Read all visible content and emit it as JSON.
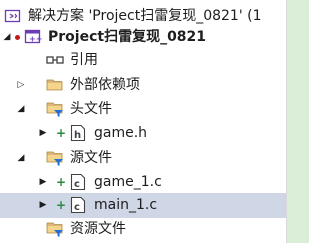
{
  "solution": {
    "label": "解决方案 'Project扫雷复现_0821' (1"
  },
  "project": {
    "label": "Project扫雷复现_0821"
  },
  "items": {
    "references": "引用",
    "external_deps": "外部依赖项",
    "header_files": "头文件",
    "game_h": "game.h",
    "source_files": "源文件",
    "game_1_c": "game_1.c",
    "main_1_c": "main_1.c",
    "resource_files": "资源文件"
  },
  "colors": {
    "selected_row": "#cfd6e5",
    "folder": "#dcb67a",
    "filter_badge": "#1f6fd6",
    "project_purple": "#6c3bb5",
    "added_plus": "#2b8a3e",
    "side_strip": "#dbeed8"
  }
}
